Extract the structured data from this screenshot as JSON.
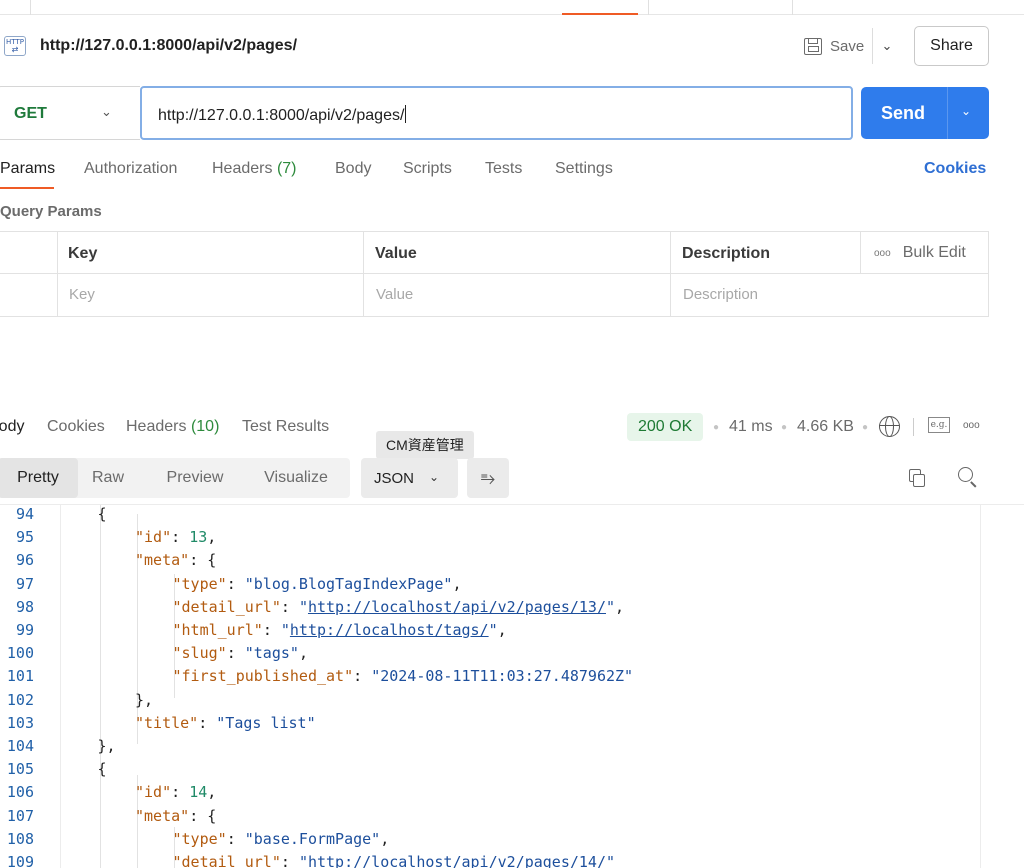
{
  "request": {
    "title": "http://127.0.0.1:8000/api/v2/pages/",
    "save_label": "Save",
    "share_label": "Share",
    "method": "GET",
    "url": "http://127.0.0.1:8000/api/v2/pages/",
    "send_label": "Send",
    "http_badge": "HTTP"
  },
  "request_tabs": {
    "params": "Params",
    "authorization": "Authorization",
    "headers": "Headers",
    "headers_count": "(7)",
    "body": "Body",
    "scripts": "Scripts",
    "tests": "Tests",
    "settings": "Settings",
    "cookies": "Cookies"
  },
  "query_params": {
    "label": "Query Params",
    "columns": [
      "Key",
      "Value",
      "Description"
    ],
    "bulk_edit": "Bulk Edit",
    "placeholders": [
      "Key",
      "Value",
      "Description"
    ]
  },
  "response_tabs": {
    "body": "Body",
    "cookies": "Cookies",
    "headers": "Headers",
    "headers_count": "(10)",
    "test_results": "Test Results"
  },
  "response_meta": {
    "status": "200 OK",
    "time": "41 ms",
    "size": "4.66 KB"
  },
  "tooltip": "CM資産管理",
  "view_modes": [
    "Pretty",
    "Raw",
    "Preview",
    "Visualize"
  ],
  "format": "JSON",
  "code_lines": [
    {
      "n": "94",
      "indent": 1,
      "parts": [
        [
          "p",
          "{"
        ]
      ]
    },
    {
      "n": "95",
      "indent": 2,
      "parts": [
        [
          "k",
          "\"id\""
        ],
        [
          "p",
          ": "
        ],
        [
          "n",
          "13"
        ],
        [
          "p",
          ","
        ]
      ]
    },
    {
      "n": "96",
      "indent": 2,
      "parts": [
        [
          "k",
          "\"meta\""
        ],
        [
          "p",
          ": {"
        ]
      ]
    },
    {
      "n": "97",
      "indent": 3,
      "parts": [
        [
          "k",
          "\"type\""
        ],
        [
          "p",
          ": "
        ],
        [
          "s",
          "\"blog.BlogTagIndexPage\""
        ],
        [
          "p",
          ","
        ]
      ]
    },
    {
      "n": "98",
      "indent": 3,
      "parts": [
        [
          "k",
          "\"detail_url\""
        ],
        [
          "p",
          ": "
        ],
        [
          "s",
          "\""
        ],
        [
          "u",
          "http://localhost/api/v2/pages/13/"
        ],
        [
          "s",
          "\""
        ],
        [
          "p",
          ","
        ]
      ]
    },
    {
      "n": "99",
      "indent": 3,
      "parts": [
        [
          "k",
          "\"html_url\""
        ],
        [
          "p",
          ": "
        ],
        [
          "s",
          "\""
        ],
        [
          "u",
          "http://localhost/tags/"
        ],
        [
          "s",
          "\""
        ],
        [
          "p",
          ","
        ]
      ]
    },
    {
      "n": "100",
      "indent": 3,
      "parts": [
        [
          "k",
          "\"slug\""
        ],
        [
          "p",
          ": "
        ],
        [
          "s",
          "\"tags\""
        ],
        [
          "p",
          ","
        ]
      ]
    },
    {
      "n": "101",
      "indent": 3,
      "parts": [
        [
          "k",
          "\"first_published_at\""
        ],
        [
          "p",
          ": "
        ],
        [
          "s",
          "\"2024-08-11T11:03:27.487962Z\""
        ]
      ]
    },
    {
      "n": "102",
      "indent": 2,
      "parts": [
        [
          "p",
          "},"
        ]
      ]
    },
    {
      "n": "103",
      "indent": 2,
      "parts": [
        [
          "k",
          "\"title\""
        ],
        [
          "p",
          ": "
        ],
        [
          "s",
          "\"Tags list\""
        ]
      ]
    },
    {
      "n": "104",
      "indent": 1,
      "parts": [
        [
          "p",
          "},"
        ]
      ]
    },
    {
      "n": "105",
      "indent": 1,
      "parts": [
        [
          "p",
          "{"
        ]
      ]
    },
    {
      "n": "106",
      "indent": 2,
      "parts": [
        [
          "k",
          "\"id\""
        ],
        [
          "p",
          ": "
        ],
        [
          "n",
          "14"
        ],
        [
          "p",
          ","
        ]
      ]
    },
    {
      "n": "107",
      "indent": 2,
      "parts": [
        [
          "k",
          "\"meta\""
        ],
        [
          "p",
          ": {"
        ]
      ]
    },
    {
      "n": "108",
      "indent": 3,
      "parts": [
        [
          "k",
          "\"type\""
        ],
        [
          "p",
          ": "
        ],
        [
          "s",
          "\"base.FormPage\""
        ],
        [
          "p",
          ","
        ]
      ]
    },
    {
      "n": "109",
      "indent": 3,
      "parts": [
        [
          "k",
          "\"detail_url\""
        ],
        [
          "p",
          ": "
        ],
        [
          "s",
          "\""
        ],
        [
          "u",
          "http://localhost/api/v2/pages/14/"
        ],
        [
          "s",
          "\""
        ]
      ]
    }
  ],
  "colors": {
    "send": "#2f7cec",
    "active_tab": "#ef5b25",
    "method": "#1f7a3b",
    "status_ok": "#1e7a34",
    "json_key": "#b25b10",
    "json_string": "#1d4f9c",
    "json_number": "#1f8a67"
  },
  "icons": [
    "http-icon",
    "save-icon",
    "chevron-down-icon",
    "globe-icon",
    "example-icon",
    "more-icon",
    "wrap-icon",
    "copy-icon",
    "search-icon"
  ]
}
